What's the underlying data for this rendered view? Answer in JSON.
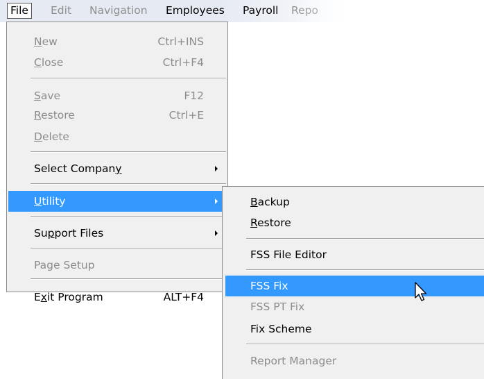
{
  "menubar": {
    "items": [
      {
        "label": "File",
        "state": "open"
      },
      {
        "label": "Edit",
        "state": "disabled"
      },
      {
        "label": "Navigation",
        "state": "disabled"
      },
      {
        "label": "Employees",
        "state": "enabled"
      },
      {
        "label": "Payroll",
        "state": "enabled"
      },
      {
        "label": "Repo",
        "state": "disabled"
      }
    ]
  },
  "file_menu": {
    "new": {
      "label_u": "N",
      "label_rest": "ew",
      "shortcut": "Ctrl+INS"
    },
    "close": {
      "label_u": "C",
      "label_rest": "lose",
      "shortcut": "Ctrl+F4"
    },
    "save": {
      "label_u": "S",
      "label_rest": "ave",
      "shortcut": "F12"
    },
    "restore": {
      "label_u": "R",
      "label_rest": "estore",
      "shortcut": "Ctrl+E"
    },
    "delete": {
      "label_u": "D",
      "label_rest": "elete"
    },
    "select_company": {
      "label_pre": "Select Compan",
      "label_u": "y"
    },
    "utility": {
      "label_u": "U",
      "label_rest": "tility"
    },
    "support_files": {
      "label_pre": "Su",
      "label_u": "p",
      "label_rest": "port Files"
    },
    "page_setup": {
      "label": "Page Setup"
    },
    "exit_program": {
      "label_pre": "E",
      "label_u": "x",
      "label_rest": "it Program",
      "shortcut": "ALT+F4"
    }
  },
  "utility_menu": {
    "backup": {
      "label_u": "B",
      "label_rest": "ackup"
    },
    "restore": {
      "label_u": "R",
      "label_rest": "estore"
    },
    "fss_file_editor": {
      "label": "FSS File Editor"
    },
    "fss_fix": {
      "label": "FSS Fix"
    },
    "fss_pt_fix": {
      "label": "FSS PT Fix"
    },
    "fix_scheme": {
      "label": "Fix Scheme"
    },
    "report_manager": {
      "label": "Report Manager"
    }
  },
  "colors": {
    "highlight": "#3399ff",
    "menu_bg": "#f0f0f0",
    "disabled_text": "#8c8c8c"
  },
  "icons": [
    "submenu-arrow-icon",
    "mouse-pointer-icon"
  ]
}
